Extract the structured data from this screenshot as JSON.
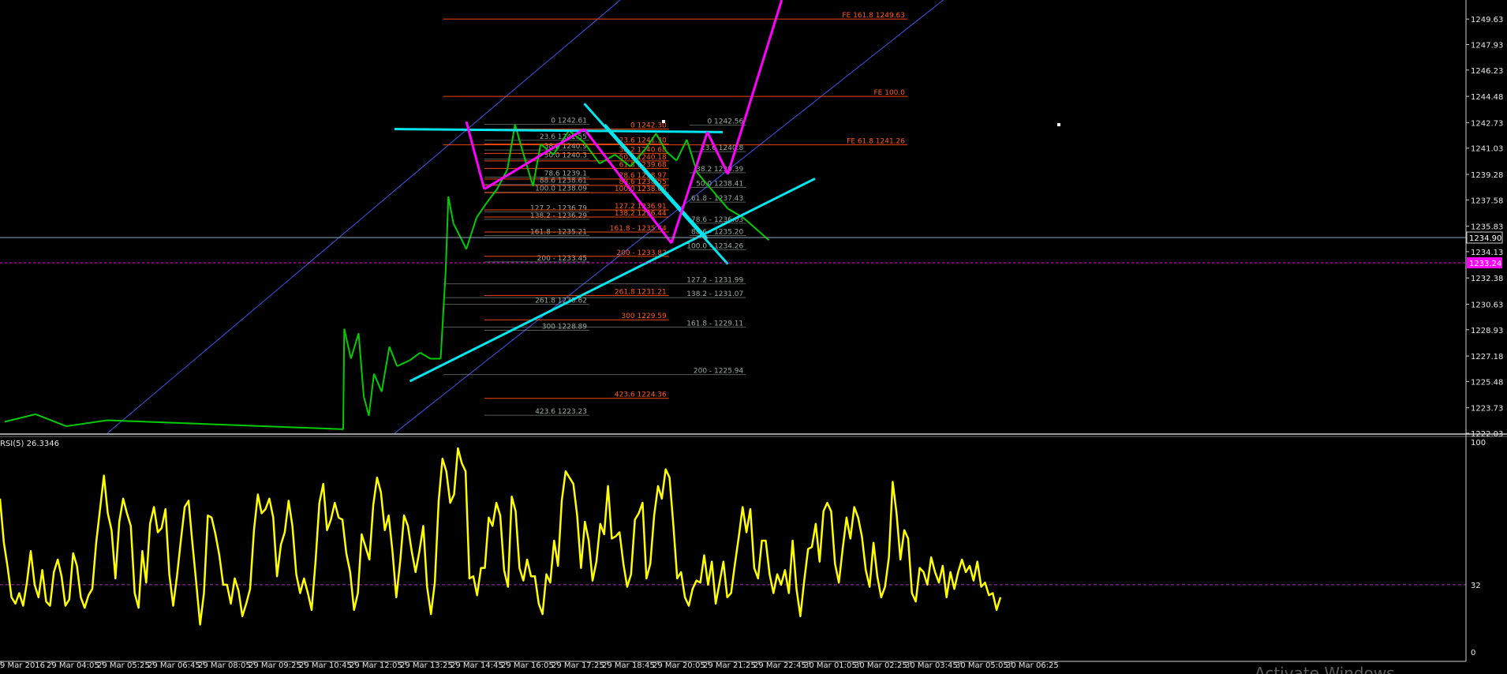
{
  "chart_data": {
    "type": "line",
    "symbol": "",
    "main_panel": {
      "y_ticks": [
        "1249.63",
        "1247.93",
        "1246.23",
        "1244.48",
        "1242.73",
        "1241.03",
        "1239.28",
        "1237.58",
        "1235.83",
        "1234.13",
        "1232.38",
        "1230.63",
        "1228.93",
        "1227.18",
        "1225.48",
        "1223.73",
        "1222.03"
      ],
      "ylim": [
        1222.03,
        1250.9
      ],
      "current_price": "1234.90",
      "marker_price": "1233.24",
      "accent_colors": {
        "trend": "#00e5ee",
        "wave": "#ff00ff",
        "fib_red": "#ff4a12",
        "fib_grey": "#8c9a92",
        "channel": "#3b55e6",
        "candles": "#00cc00"
      },
      "price_path": [
        {
          "t": 0.0,
          "p": 1222.8
        },
        {
          "t": 0.6,
          "p": 1223.3
        },
        {
          "t": 1.2,
          "p": 1222.5
        },
        {
          "t": 2.0,
          "p": 1222.9
        },
        {
          "t": 6.6,
          "p": 1222.3
        },
        {
          "t": 6.62,
          "p": 1229.0
        },
        {
          "t": 6.75,
          "p": 1227.0
        },
        {
          "t": 6.9,
          "p": 1228.7
        },
        {
          "t": 7.0,
          "p": 1224.5
        },
        {
          "t": 7.1,
          "p": 1223.2
        },
        {
          "t": 7.2,
          "p": 1226.0
        },
        {
          "t": 7.35,
          "p": 1224.8
        },
        {
          "t": 7.5,
          "p": 1227.8
        },
        {
          "t": 7.65,
          "p": 1226.5
        },
        {
          "t": 7.9,
          "p": 1226.9
        },
        {
          "t": 8.1,
          "p": 1227.4
        },
        {
          "t": 8.3,
          "p": 1227.0
        },
        {
          "t": 8.5,
          "p": 1227.0
        },
        {
          "t": 8.6,
          "p": 1233.0
        },
        {
          "t": 8.65,
          "p": 1237.8
        },
        {
          "t": 8.75,
          "p": 1236.0
        },
        {
          "t": 8.9,
          "p": 1235.0
        },
        {
          "t": 9.0,
          "p": 1234.3
        },
        {
          "t": 9.2,
          "p": 1236.4
        },
        {
          "t": 9.4,
          "p": 1237.4
        },
        {
          "t": 9.6,
          "p": 1238.3
        },
        {
          "t": 9.8,
          "p": 1239.6
        },
        {
          "t": 9.95,
          "p": 1242.6
        },
        {
          "t": 10.1,
          "p": 1240.8
        },
        {
          "t": 10.3,
          "p": 1238.5
        },
        {
          "t": 10.45,
          "p": 1241.3
        },
        {
          "t": 10.7,
          "p": 1240.6
        },
        {
          "t": 11.0,
          "p": 1242.2
        },
        {
          "t": 11.3,
          "p": 1241.4
        },
        {
          "t": 11.6,
          "p": 1240.0
        },
        {
          "t": 11.9,
          "p": 1240.6
        },
        {
          "t": 12.2,
          "p": 1239.8
        },
        {
          "t": 12.5,
          "p": 1241.0
        },
        {
          "t": 12.7,
          "p": 1242.0
        },
        {
          "t": 12.9,
          "p": 1240.8
        },
        {
          "t": 13.1,
          "p": 1240.2
        },
        {
          "t": 13.3,
          "p": 1241.6
        },
        {
          "t": 13.5,
          "p": 1239.4
        },
        {
          "t": 13.8,
          "p": 1238.2
        },
        {
          "t": 14.1,
          "p": 1237.0
        },
        {
          "t": 14.4,
          "p": 1236.4
        },
        {
          "t": 14.7,
          "p": 1235.5
        },
        {
          "t": 14.9,
          "p": 1234.9
        }
      ],
      "fib_levels": [
        {
          "label": "FE 161.8 1249.63",
          "price": 1249.63,
          "t0": 8.55,
          "t1": 17.6,
          "color": "red"
        },
        {
          "label": "FE 100.0",
          "price": 1244.48,
          "t0": 8.55,
          "t1": 17.6,
          "color": "red"
        },
        {
          "label": "FE 61.8 1241.26",
          "price": 1241.26,
          "t0": 8.55,
          "t1": 17.6,
          "color": "red"
        },
        {
          "label": "0 1242.56",
          "price": 1242.56,
          "t0": 13.35,
          "t1": 14.45,
          "color": "grey"
        },
        {
          "label": "23.6 1240.8",
          "price": 1240.8,
          "t0": 13.35,
          "t1": 14.45,
          "color": "grey"
        },
        {
          "label": "38.2 1239.39",
          "price": 1239.39,
          "t0": 13.35,
          "t1": 14.45,
          "color": "grey"
        },
        {
          "label": "50.0 1238.41",
          "price": 1238.41,
          "t0": 13.35,
          "t1": 14.45,
          "color": "grey"
        },
        {
          "label": "61.8 - 1237.43",
          "price": 1237.43,
          "t0": 13.35,
          "t1": 14.45,
          "color": "grey"
        },
        {
          "label": "78.6 - 1236.03",
          "price": 1236.03,
          "t0": 13.35,
          "t1": 14.45,
          "color": "grey"
        },
        {
          "label": "88.6 - 1235.20",
          "price": 1235.2,
          "t0": 13.35,
          "t1": 14.45,
          "color": "grey"
        },
        {
          "label": "100.0 - 1234.26",
          "price": 1234.26,
          "t0": 13.35,
          "t1": 14.45,
          "color": "grey"
        },
        {
          "label": "127.2 - 1231.99",
          "price": 1231.99,
          "t0": 8.55,
          "t1": 14.45,
          "color": "grey"
        },
        {
          "label": "138.2 - 1231.07",
          "price": 1231.07,
          "t0": 8.55,
          "t1": 14.45,
          "color": "grey"
        },
        {
          "label": "161.8 - 1229.11",
          "price": 1229.11,
          "t0": 8.55,
          "t1": 14.45,
          "color": "grey"
        },
        {
          "label": "200 - 1225.94",
          "price": 1225.94,
          "t0": 8.55,
          "t1": 14.45,
          "color": "grey"
        },
        {
          "label": "0 1242.61",
          "price": 1242.61,
          "t0": 9.35,
          "t1": 11.4,
          "color": "grey"
        },
        {
          "label": "23.6 1241.55",
          "price": 1241.55,
          "t0": 9.35,
          "t1": 11.4,
          "color": "grey"
        },
        {
          "label": "38.2 1240.9",
          "price": 1240.9,
          "t0": 9.35,
          "t1": 11.4,
          "color": "grey"
        },
        {
          "label": "50.0 1240.3",
          "price": 1240.3,
          "t0": 9.35,
          "t1": 11.4,
          "color": "grey"
        },
        {
          "label": "78.6 1239.1",
          "price": 1239.1,
          "t0": 9.35,
          "t1": 11.4,
          "color": "grey"
        },
        {
          "label": "88.6 1238.61",
          "price": 1238.61,
          "t0": 9.35,
          "t1": 11.4,
          "color": "grey"
        },
        {
          "label": "100.0 1238.09",
          "price": 1238.09,
          "t0": 9.35,
          "t1": 11.4,
          "color": "grey"
        },
        {
          "label": "127.2 - 1236.79",
          "price": 1236.79,
          "t0": 9.35,
          "t1": 11.4,
          "color": "grey"
        },
        {
          "label": "138.2 - 1236.29",
          "price": 1236.29,
          "t0": 9.35,
          "t1": 11.4,
          "color": "grey"
        },
        {
          "label": "161.8 - 1235.21",
          "price": 1235.21,
          "t0": 9.35,
          "t1": 11.4,
          "color": "grey"
        },
        {
          "label": "200 - 1233.45",
          "price": 1233.45,
          "t0": 9.35,
          "t1": 11.4,
          "color": "grey"
        },
        {
          "label": "261.8 1230.62",
          "price": 1230.62,
          "t0": 8.55,
          "t1": 11.4,
          "color": "grey"
        },
        {
          "label": "300 1228.89",
          "price": 1228.89,
          "t0": 9.35,
          "t1": 11.4,
          "color": "grey"
        },
        {
          "label": "423.6 1223.23",
          "price": 1223.23,
          "t0": 9.35,
          "t1": 11.4,
          "color": "grey"
        },
        {
          "label": "0 1242.30",
          "price": 1242.3,
          "t0": 9.35,
          "t1": 12.95,
          "color": "red"
        },
        {
          "label": "23.6 1241.30",
          "price": 1241.3,
          "t0": 9.35,
          "t1": 12.95,
          "color": "red"
        },
        {
          "label": "38.2 1240.68",
          "price": 1240.68,
          "t0": 9.35,
          "t1": 12.95,
          "color": "red"
        },
        {
          "label": "50.0 1240.18",
          "price": 1240.18,
          "t0": 9.35,
          "t1": 12.95,
          "color": "red"
        },
        {
          "label": "61.8 1239.68",
          "price": 1239.68,
          "t0": 9.35,
          "t1": 12.95,
          "color": "red"
        },
        {
          "label": "78.6 1238.97",
          "price": 1238.97,
          "t0": 9.35,
          "t1": 12.95,
          "color": "red"
        },
        {
          "label": "88.6 1238.55",
          "price": 1238.55,
          "t0": 9.35,
          "t1": 12.95,
          "color": "red"
        },
        {
          "label": "100.0 1238.06",
          "price": 1238.06,
          "t0": 9.35,
          "t1": 12.95,
          "color": "red"
        },
        {
          "label": "127.2 1236.91",
          "price": 1236.91,
          "t0": 9.35,
          "t1": 12.95,
          "color": "red"
        },
        {
          "label": "138.2 1236.44",
          "price": 1236.44,
          "t0": 9.35,
          "t1": 12.95,
          "color": "red"
        },
        {
          "label": "161.8 - 1235.44",
          "price": 1235.44,
          "t0": 9.35,
          "t1": 12.95,
          "color": "red"
        },
        {
          "label": "200 - 1233.82",
          "price": 1233.82,
          "t0": 9.35,
          "t1": 12.95,
          "color": "red"
        },
        {
          "label": "261.8 1231.21",
          "price": 1231.21,
          "t0": 9.35,
          "t1": 12.95,
          "color": "red"
        },
        {
          "label": "300 1229.59",
          "price": 1229.59,
          "t0": 9.35,
          "t1": 12.95,
          "color": "red"
        },
        {
          "label": "423.6 1224.36",
          "price": 1224.36,
          "t0": 9.35,
          "t1": 12.95,
          "color": "red"
        }
      ],
      "trendlines": [
        {
          "name": "channel-upper",
          "color": "channel",
          "from": {
            "t": 2.0,
            "p": 1222.03
          },
          "to": {
            "t": 12.0,
            "p": 1250.9
          }
        },
        {
          "name": "channel-lower",
          "color": "channel",
          "from": {
            "t": 7.6,
            "p": 1222.03
          },
          "to": {
            "t": 18.3,
            "p": 1250.9
          }
        },
        {
          "name": "resistance-top",
          "color": "trend",
          "from": {
            "t": 7.6,
            "p": 1242.3
          },
          "to": {
            "t": 14.0,
            "p": 1242.1
          }
        },
        {
          "name": "support-rising",
          "color": "trend",
          "from": {
            "t": 7.9,
            "p": 1225.5
          },
          "to": {
            "t": 15.8,
            "p": 1239.0
          }
        },
        {
          "name": "down-channel",
          "color": "trend",
          "from": {
            "t": 11.3,
            "p": 1244.0
          },
          "to": {
            "t": 14.1,
            "p": 1233.3
          }
        },
        {
          "name": "down-channel-2",
          "color": "trend",
          "from": {
            "t": 11.7,
            "p": 1242.6
          },
          "to": {
            "t": 13.7,
            "p": 1235.0
          }
        }
      ],
      "wave_path": [
        {
          "t": 9.0,
          "p": 1242.8
        },
        {
          "t": 9.35,
          "p": 1238.3
        },
        {
          "t": 11.3,
          "p": 1242.3
        },
        {
          "t": 13.0,
          "p": 1234.7
        },
        {
          "t": 13.7,
          "p": 1242.1
        },
        {
          "t": 14.1,
          "p": 1239.3
        },
        {
          "t": 15.15,
          "p": 1250.9
        }
      ]
    },
    "rsi_panel": {
      "label": "RSI(5) 26.3346",
      "y_ticks": [
        "100",
        "32",
        "0"
      ],
      "ylim": [
        0,
        100
      ],
      "level": 32,
      "values": [
        73,
        52,
        40,
        26,
        23,
        28,
        22,
        33,
        48,
        32,
        26,
        39,
        24,
        22,
        38,
        44,
        36,
        22,
        25,
        47,
        41,
        26,
        21,
        27,
        30,
        52,
        68,
        84,
        66,
        58,
        35,
        62,
        73,
        66,
        60,
        28,
        21,
        48,
        33,
        61,
        69,
        57,
        59,
        68,
        37,
        22,
        36,
        53,
        69,
        72,
        52,
        33,
        13,
        28,
        65,
        64,
        56,
        46,
        32,
        32,
        23,
        35,
        29,
        17,
        23,
        30,
        58,
        75,
        66,
        68,
        73,
        64,
        36,
        51,
        57,
        72,
        60,
        37,
        28,
        35,
        28,
        20,
        43,
        71,
        80,
        58,
        63,
        71,
        64,
        63,
        47,
        38,
        20,
        28,
        56,
        50,
        44,
        70,
        83,
        76,
        58,
        65,
        48,
        26,
        43,
        65,
        60,
        48,
        38,
        48,
        60,
        31,
        18,
        33,
        72,
        92,
        86,
        71,
        75,
        97,
        90,
        86,
        35,
        36,
        27,
        40,
        40,
        64,
        60,
        71,
        65,
        39,
        31,
        74,
        67,
        40,
        34,
        44,
        36,
        36,
        23,
        18,
        37,
        33,
        53,
        41,
        72,
        86,
        83,
        80,
        65,
        40,
        62,
        53,
        34,
        43,
        61,
        56,
        79,
        54,
        55,
        57,
        42,
        31,
        37,
        63,
        66,
        71,
        35,
        42,
        65,
        79,
        73,
        87,
        83,
        60,
        35,
        38,
        26,
        22,
        30,
        34,
        33,
        46,
        32,
        43,
        23,
        33,
        43,
        26,
        28,
        42,
        55,
        69,
        57,
        68,
        40,
        35,
        53,
        53,
        37,
        28,
        37,
        32,
        39,
        28,
        53,
        30,
        17,
        34,
        49,
        50,
        61,
        43,
        67,
        71,
        67,
        42,
        33,
        49,
        64,
        54,
        69,
        64,
        55,
        39,
        31,
        52,
        36,
        26,
        31,
        45,
        81,
        66,
        44,
        58,
        54,
        28,
        24,
        40,
        38,
        32,
        45,
        38,
        33,
        41,
        26,
        38,
        30,
        38,
        44,
        38,
        41,
        34,
        43,
        31,
        33,
        27,
        28,
        20,
        26
      ]
    },
    "x_ticks": [
      "9 Mar 2016",
      "29 Mar 04:05",
      "29 Mar 05:25",
      "29 Mar 06:45",
      "29 Mar 08:05",
      "29 Mar 09:25",
      "29 Mar 10:45",
      "29 Mar 12:05",
      "29 Mar 13:25",
      "29 Mar 14:45",
      "29 Mar 16:05",
      "29 Mar 17:25",
      "29 Mar 18:45",
      "29 Mar 20:05",
      "29 Mar 21:25",
      "29 Mar 22:45",
      "30 Mar 01:05",
      "30 Mar 02:25",
      "30 Mar 03:45",
      "30 Mar 05:05",
      "30 Mar 06:25"
    ],
    "watermark": "Activate Windows"
  }
}
